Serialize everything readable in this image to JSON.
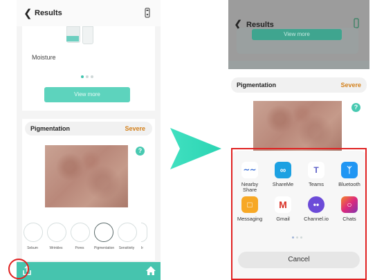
{
  "left": {
    "title": "Results",
    "moisture_label": "Moisture",
    "view_more": "View more",
    "pigmentation_label": "Pigmentation",
    "pigmentation_severity": "Severe",
    "help": "?",
    "categories": [
      "Sebum",
      "Wrinkles",
      "Pores",
      "Pigmentation",
      "Sensitivity",
      "Ir"
    ]
  },
  "right": {
    "title": "Results",
    "view_more": "View more",
    "pigmentation_label": "Pigmentation",
    "pigmentation_severity": "Severe",
    "help": "?",
    "apps": [
      {
        "label": "Nearby Share",
        "icon": "nearby-share-icon",
        "color": "#ffffff"
      },
      {
        "label": "ShareMe",
        "icon": "shareme-icon",
        "color": "#1da1e2"
      },
      {
        "label": "Teams",
        "icon": "teams-icon",
        "color": "#ffffff"
      },
      {
        "label": "Bluetooth",
        "icon": "bluetooth-icon",
        "color": "#2196f3"
      },
      {
        "label": "Messaging",
        "icon": "messaging-icon",
        "color": "#f7a825"
      },
      {
        "label": "Gmail",
        "icon": "gmail-icon",
        "color": "#ffffff"
      },
      {
        "label": "Channel.io",
        "icon": "channel-io-icon",
        "color": "#6c4bd8"
      },
      {
        "label": "Chats",
        "icon": "chats-icon",
        "color": "#e0338c"
      }
    ],
    "cancel": "Cancel"
  },
  "colors": {
    "accent": "#46c4ae",
    "severity": "#d3801b",
    "highlight": "#e02020"
  }
}
